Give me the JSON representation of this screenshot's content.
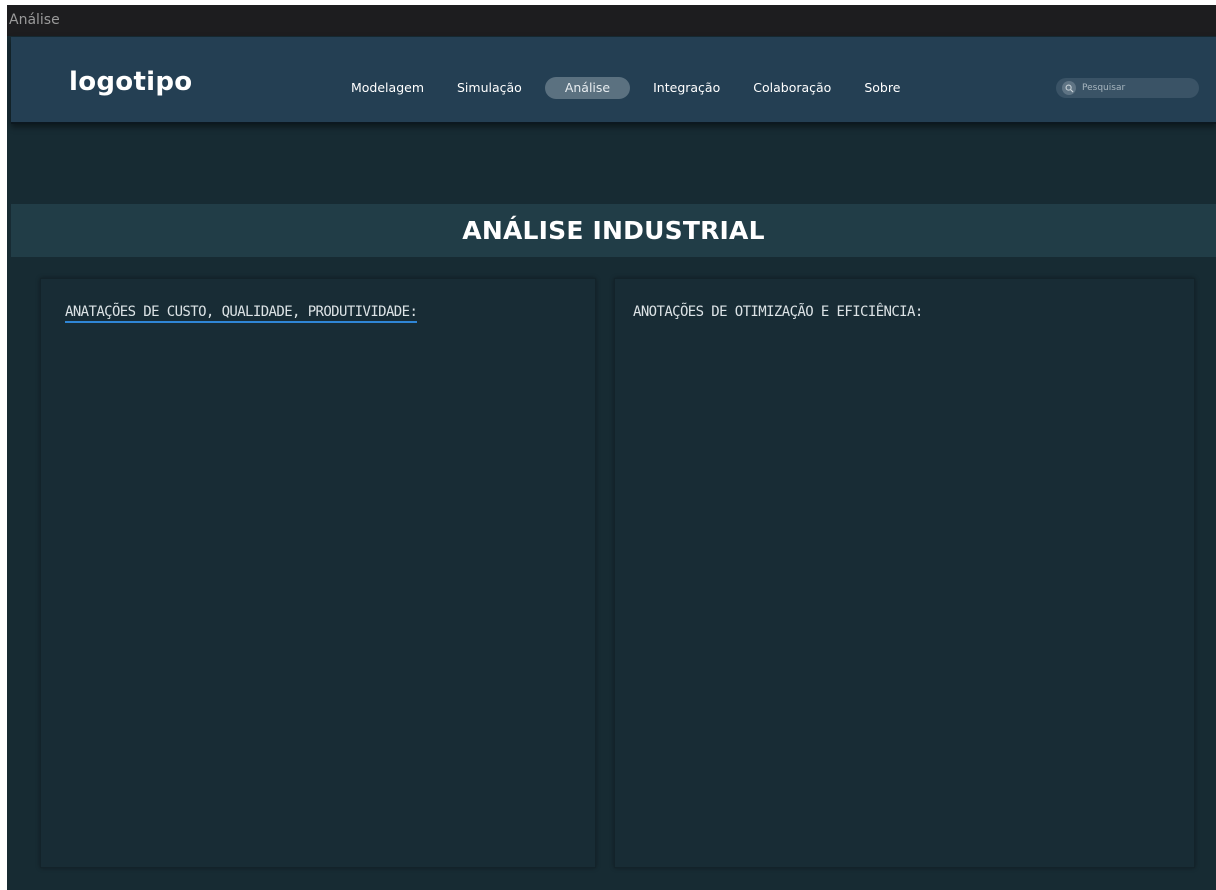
{
  "window": {
    "title": "Análise"
  },
  "navbar": {
    "logo": "logotipo",
    "items": [
      {
        "label": "Modelagem",
        "active": false
      },
      {
        "label": "Simulação",
        "active": false
      },
      {
        "label": "Análise",
        "active": true
      },
      {
        "label": "Integração",
        "active": false
      },
      {
        "label": "Colaboração",
        "active": false
      },
      {
        "label": "Sobre",
        "active": false
      }
    ],
    "search": {
      "placeholder": "Pesquisar",
      "icon": "search-icon"
    }
  },
  "banner": {
    "title": "ANÁLISE INDUSTRIAL"
  },
  "panels": {
    "left": {
      "label": "ANATAÇÕES DE CUSTO, QUALIDADE, PRODUTIVIDADE:"
    },
    "right": {
      "label": "ANOTAÇÕES DE OTIMIZAÇÃO E EFICIÊNCIA:"
    }
  },
  "colors": {
    "background": "#172b33",
    "navbar": "#243f53",
    "banner": "#213d47",
    "active_tab": "#5b7180",
    "link_underline": "#2f86d6"
  }
}
